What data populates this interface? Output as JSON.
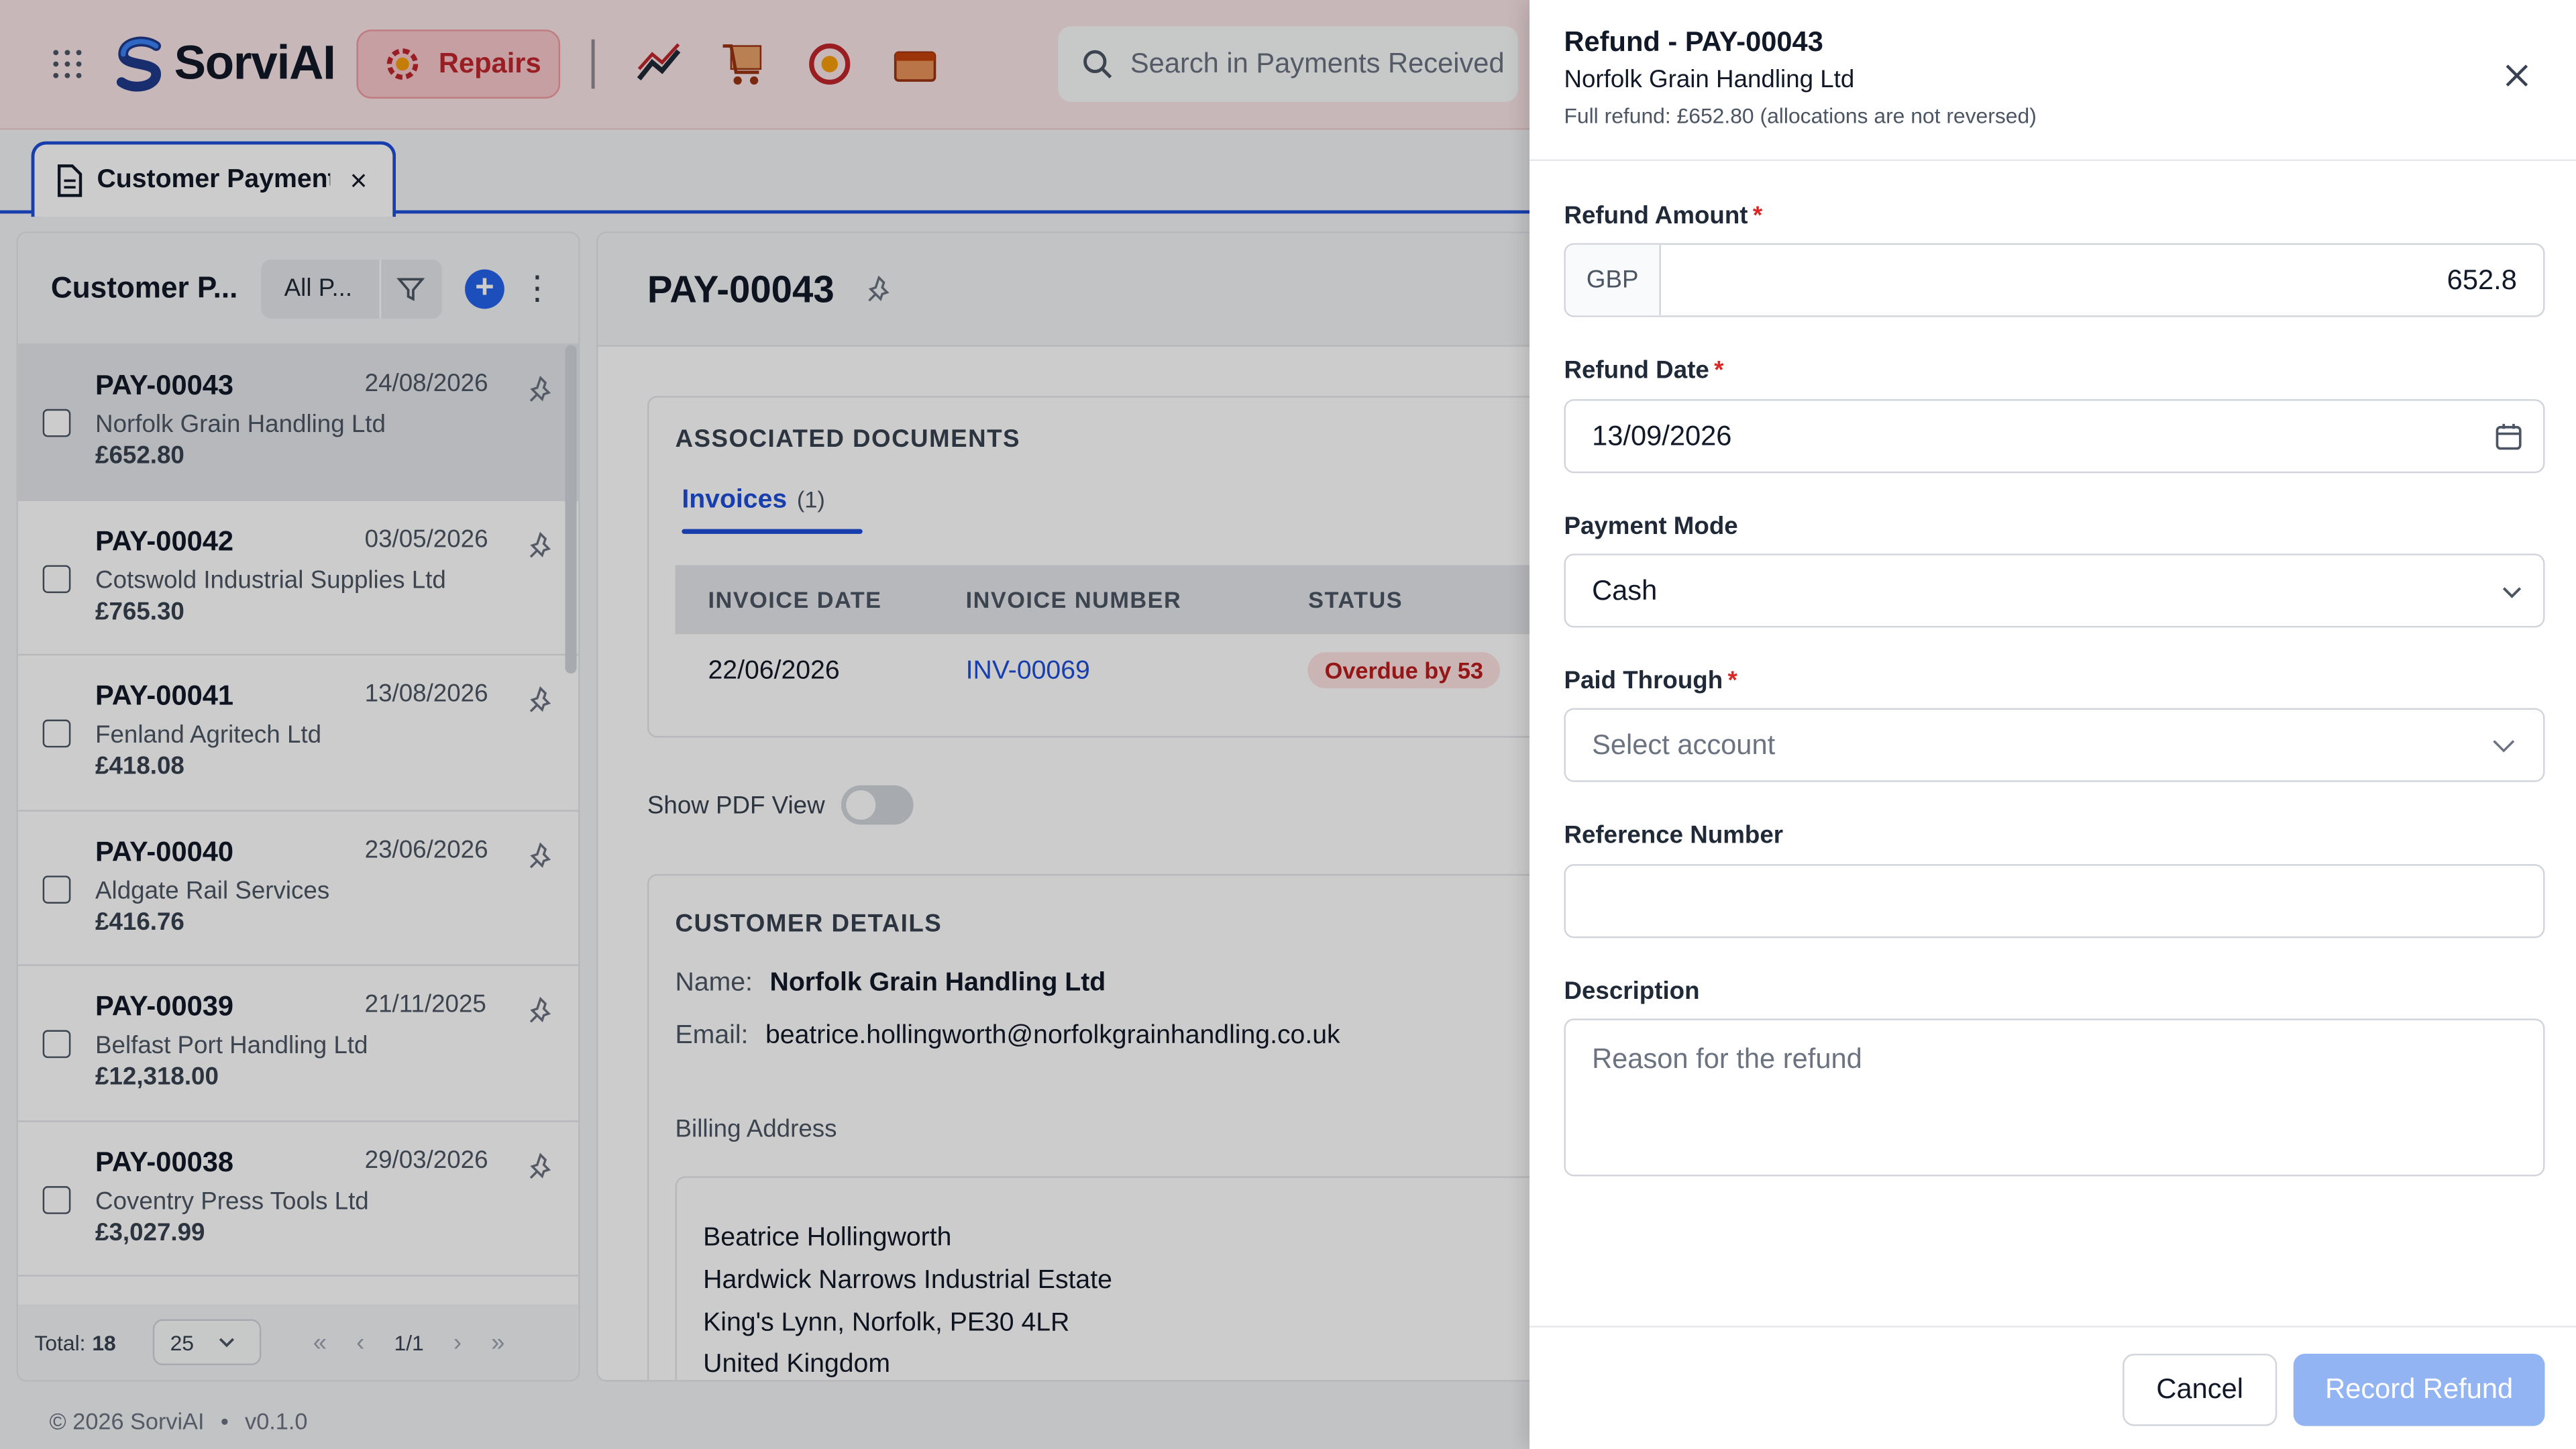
{
  "app": {
    "name": "SorviAI",
    "module": "Repairs",
    "search_placeholder": "Search in Payments Received"
  },
  "tab": {
    "label": "Customer Payments"
  },
  "list": {
    "title": "Customer P...",
    "filter": "All P...",
    "items": [
      {
        "id": "PAY-00043",
        "date": "24/08/2026",
        "name": "Norfolk Grain Handling Ltd",
        "amount": "£652.80"
      },
      {
        "id": "PAY-00042",
        "date": "03/05/2026",
        "name": "Cotswold Industrial Supplies Ltd",
        "amount": "£765.30"
      },
      {
        "id": "PAY-00041",
        "date": "13/08/2026",
        "name": "Fenland Agritech Ltd",
        "amount": "£418.08"
      },
      {
        "id": "PAY-00040",
        "date": "23/06/2026",
        "name": "Aldgate Rail Services",
        "amount": "£416.76"
      },
      {
        "id": "PAY-00039",
        "date": "21/11/2025",
        "name": "Belfast Port Handling Ltd",
        "amount": "£12,318.00"
      },
      {
        "id": "PAY-00038",
        "date": "29/03/2026",
        "name": "Coventry Press Tools Ltd",
        "amount": "£3,027.99"
      }
    ],
    "total_label": "Total:",
    "total": "18",
    "per_page": "25",
    "page": "1/1"
  },
  "detail": {
    "title": "PAY-00043",
    "assoc_title": "ASSOCIATED DOCUMENTS",
    "invoices_tab": "Invoices",
    "invoices_count": "(1)",
    "columns": [
      "INVOICE DATE",
      "INVOICE NUMBER",
      "STATUS"
    ],
    "invoice": {
      "date": "22/06/2026",
      "number": "INV-00069",
      "status": "Overdue by 53"
    },
    "pdf_label": "Show PDF View",
    "customer_title": "CUSTOMER DETAILS",
    "name_label": "Name:",
    "name": "Norfolk Grain Handling Ltd",
    "email_label": "Email:",
    "email": "beatrice.hollingworth@norfolkgrainhandling.co.uk",
    "billing_label": "Billing Address",
    "address": [
      "Beatrice Hollingworth",
      "Hardwick Narrows Industrial Estate",
      "King's Lynn, Norfolk, PE30 4LR",
      "United Kingdom"
    ]
  },
  "footer": {
    "copyright": "© 2026 SorviAI",
    "bullet": "•",
    "version": "v0.1.0"
  },
  "refund": {
    "title": "Refund - PAY-00043",
    "customer": "Norfolk Grain Handling Ltd",
    "note": "Full refund: £652.80 (allocations are not reversed)",
    "amount_label": "Refund Amount",
    "currency": "GBP",
    "amount": "652.8",
    "date_label": "Refund Date",
    "date": "13/09/2026",
    "mode_label": "Payment Mode",
    "mode": "Cash",
    "paid_through_label": "Paid Through",
    "paid_through_placeholder": "Select account",
    "reference_label": "Reference Number",
    "reference": "",
    "description_label": "Description",
    "description_placeholder": "Reason for the refund",
    "required_mark": "*",
    "cancel": "Cancel",
    "submit": "Record Refund"
  },
  "colors": {
    "accent": "#1d4ed8",
    "danger": "#dc2626",
    "primary_disabled": "#93b4f3",
    "header_bg": "#fbe5e6"
  }
}
